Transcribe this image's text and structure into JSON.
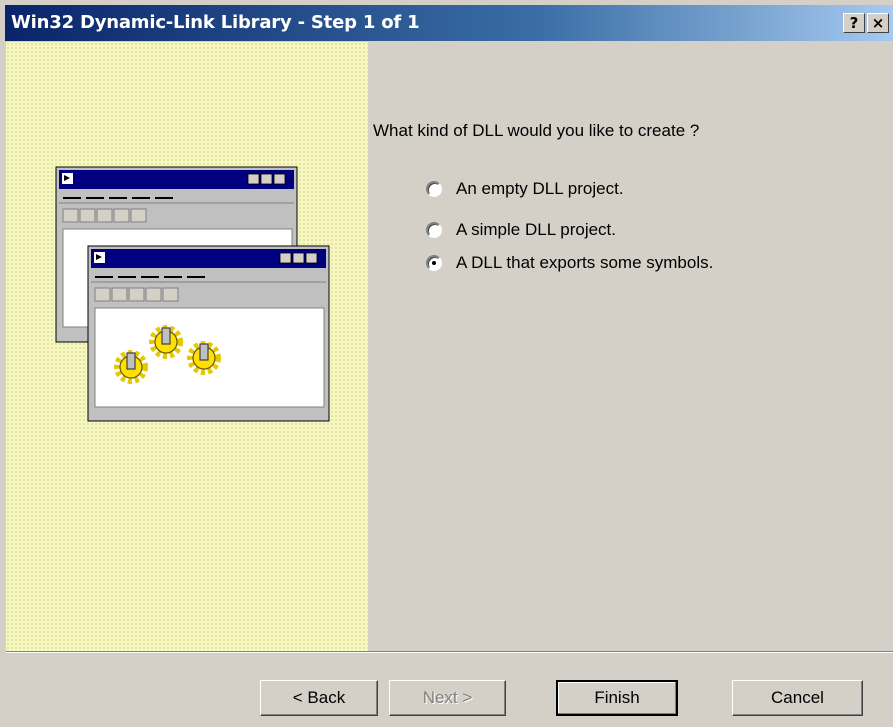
{
  "window": {
    "title": "Win32 Dynamic-Link Library - Step 1 of 1",
    "help_glyph": "?",
    "close_glyph": "×"
  },
  "content": {
    "question": "What kind of DLL would you like to create ?",
    "options": [
      {
        "label": "An empty DLL project.",
        "checked": false
      },
      {
        "label": "A simple DLL project.",
        "checked": false
      },
      {
        "label": "A DLL that exports some symbols.",
        "checked": true
      }
    ]
  },
  "buttons": {
    "back": "< Back",
    "next": "Next >",
    "finish": "Finish",
    "cancel": "Cancel"
  },
  "colors": {
    "title_active": "#0a246a",
    "face": "#d4d0c8",
    "illustration_bg": "#f7f7c0"
  }
}
